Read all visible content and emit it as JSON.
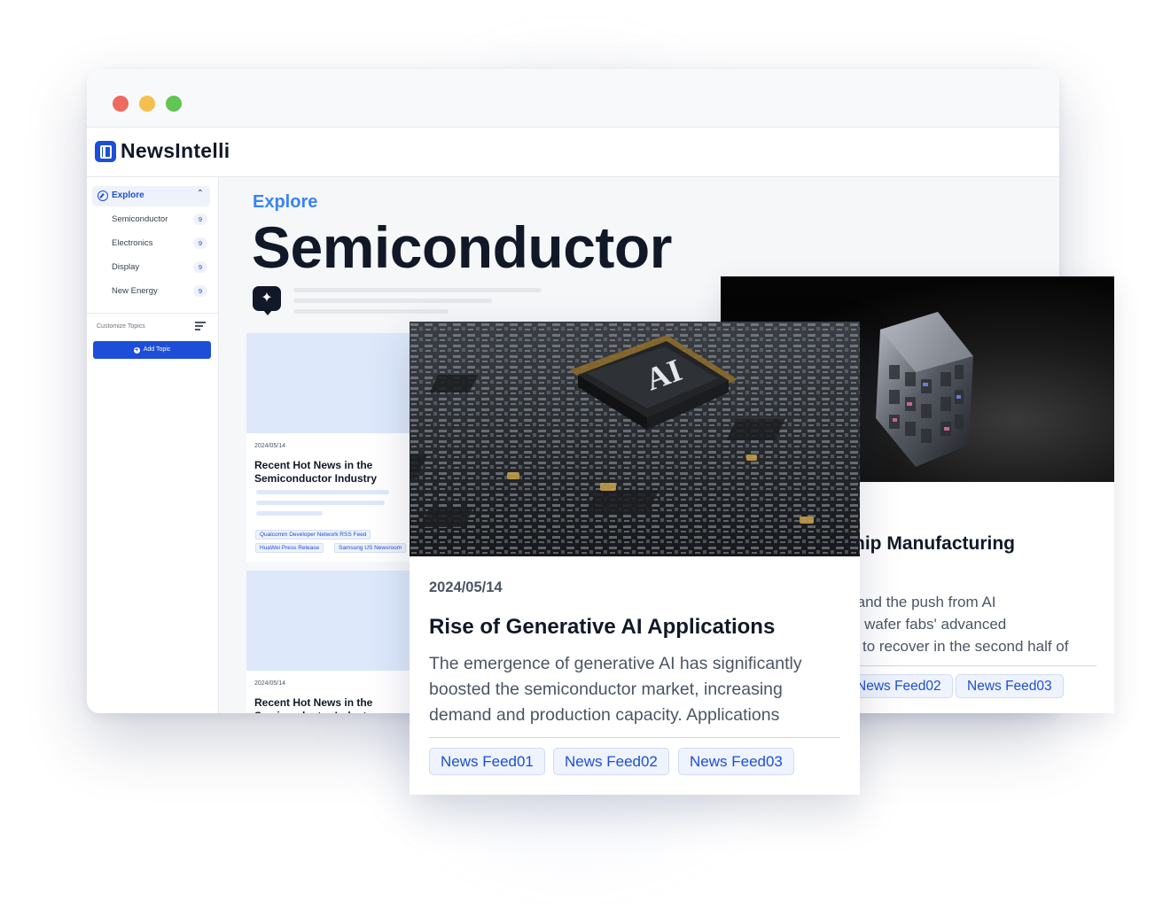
{
  "app": {
    "name": "NewsIntelli"
  },
  "sidebar": {
    "explore_label": "Explore",
    "items": [
      {
        "label": "Semiconductor",
        "count": "9"
      },
      {
        "label": "Electronics",
        "count": "9"
      },
      {
        "label": "Display",
        "count": "9"
      },
      {
        "label": "New Energy",
        "count": "9"
      }
    ],
    "customize_label": "Customize Topics",
    "add_topic_label": "Add Topic"
  },
  "main": {
    "breadcrumb": "Explore",
    "title": "Semiconductor",
    "cards": [
      {
        "date": "2024/05/14",
        "title": "Recent Hot News in the Semiconductor Industry",
        "tags": [
          "Qualcomm Developer Network RSS Feed",
          "HuaWei Press Release",
          "Samsung US Newsroom"
        ]
      },
      {
        "date": "2024/05/14",
        "title": "Recent Hot News in the Semiconductor Industry"
      }
    ]
  },
  "front_card": {
    "image_label": "AI",
    "date": "2024/05/14",
    "title": "Rise of Generative AI Applications",
    "text": "The emergence of generative AI has significantly boosted the semiconductor market, increasing demand and production capacity. Applications",
    "tags": [
      "News Feed01",
      "News Feed02",
      "News Feed03"
    ]
  },
  "back_card": {
    "title": "hip Manufacturing",
    "text_lines": [
      "nd and the push from AI",
      "nch wafer fabs' advanced",
      "to recover in the second half of"
    ],
    "tags": [
      "News Feed02",
      "News Feed03"
    ]
  },
  "colors": {
    "accent": "#1d4ed8",
    "accent_light": "#3b82f6",
    "tag_bg": "#eef3fd",
    "traffic_red": "#ec6a5e",
    "traffic_yellow": "#f4bf4f",
    "traffic_green": "#61c554"
  }
}
